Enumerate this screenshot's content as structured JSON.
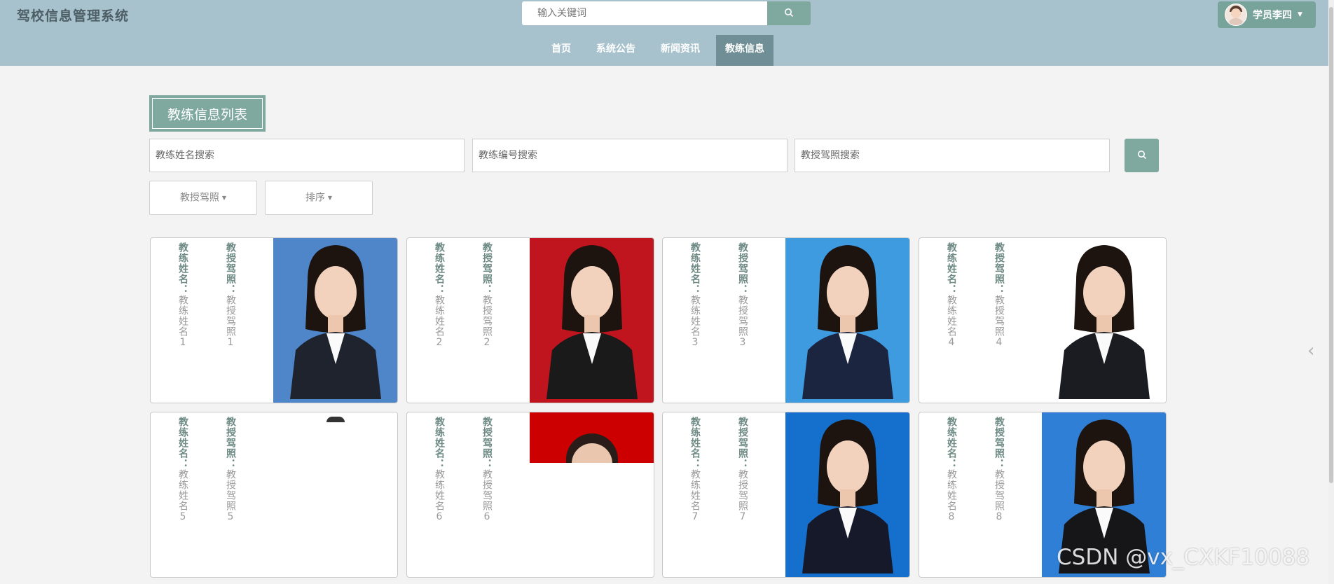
{
  "app": {
    "title": "驾校信息管理系统"
  },
  "header": {
    "search": {
      "placeholder": "输入关键词"
    },
    "user": {
      "name": "学员李四"
    },
    "nav": [
      {
        "label": "首页"
      },
      {
        "label": "系统公告"
      },
      {
        "label": "新闻资讯"
      },
      {
        "label": "教练信息",
        "active": true
      }
    ]
  },
  "main": {
    "section_title": "教练信息列表",
    "filters": {
      "name_placeholder": "教练姓名搜索",
      "id_placeholder": "教练编号搜索",
      "license_placeholder": "教授驾照搜索"
    },
    "dropdowns": [
      {
        "label": "教授驾照"
      },
      {
        "label": "排序"
      }
    ],
    "cards": [
      {
        "name_label": "教练姓名：",
        "name": "教练姓名1",
        "license_label": "教授驾照：",
        "license": "教授驾照1",
        "photo_bg": "#4e86c9",
        "suit": "#1f232e"
      },
      {
        "name_label": "教练姓名：",
        "name": "教练姓名2",
        "license_label": "教授驾照：",
        "license": "教授驾照2",
        "photo_bg": "#c0141e",
        "suit": "#1a1a1a"
      },
      {
        "name_label": "教练姓名：",
        "name": "教练姓名3",
        "license_label": "教授驾照：",
        "license": "教授驾照3",
        "photo_bg": "#3f9be0",
        "suit": "#1c2540"
      },
      {
        "name_label": "教练姓名：",
        "name": "教练姓名4",
        "license_label": "教授驾照：",
        "license": "教授驾照4",
        "photo_bg": "#ffffff",
        "suit": "#1a1c22"
      },
      {
        "name_label": "教练姓名：",
        "name": "教练姓名5",
        "license_label": "教授驾照：",
        "license": "教授驾照5",
        "photo_bg": "#ffffff",
        "suit": "#ffffff"
      },
      {
        "name_label": "教练姓名：",
        "name": "教练姓名6",
        "license_label": "教授驾照：",
        "license": "教授驾照6",
        "photo_bg": "#cc0000",
        "suit": "#ffffff"
      },
      {
        "name_label": "教练姓名：",
        "name": "教练姓名7",
        "license_label": "教授驾照：",
        "license": "教授驾照7",
        "photo_bg": "#1470cc",
        "suit": "#15192a"
      },
      {
        "name_label": "教练姓名：",
        "name": "教练姓名8",
        "license_label": "教授驾照：",
        "license": "教授驾照8",
        "photo_bg": "#2f7fd6",
        "suit": "#161618"
      }
    ]
  },
  "watermark": "CSDN @vx_CXKF10088",
  "colors": {
    "header_bg": "#a7c2cc",
    "accent": "#7fa89f",
    "nav_active": "#6f8e96"
  },
  "icons": {
    "search": "search-icon",
    "caret": "caret-down-icon",
    "next": "chevron-right-icon"
  }
}
